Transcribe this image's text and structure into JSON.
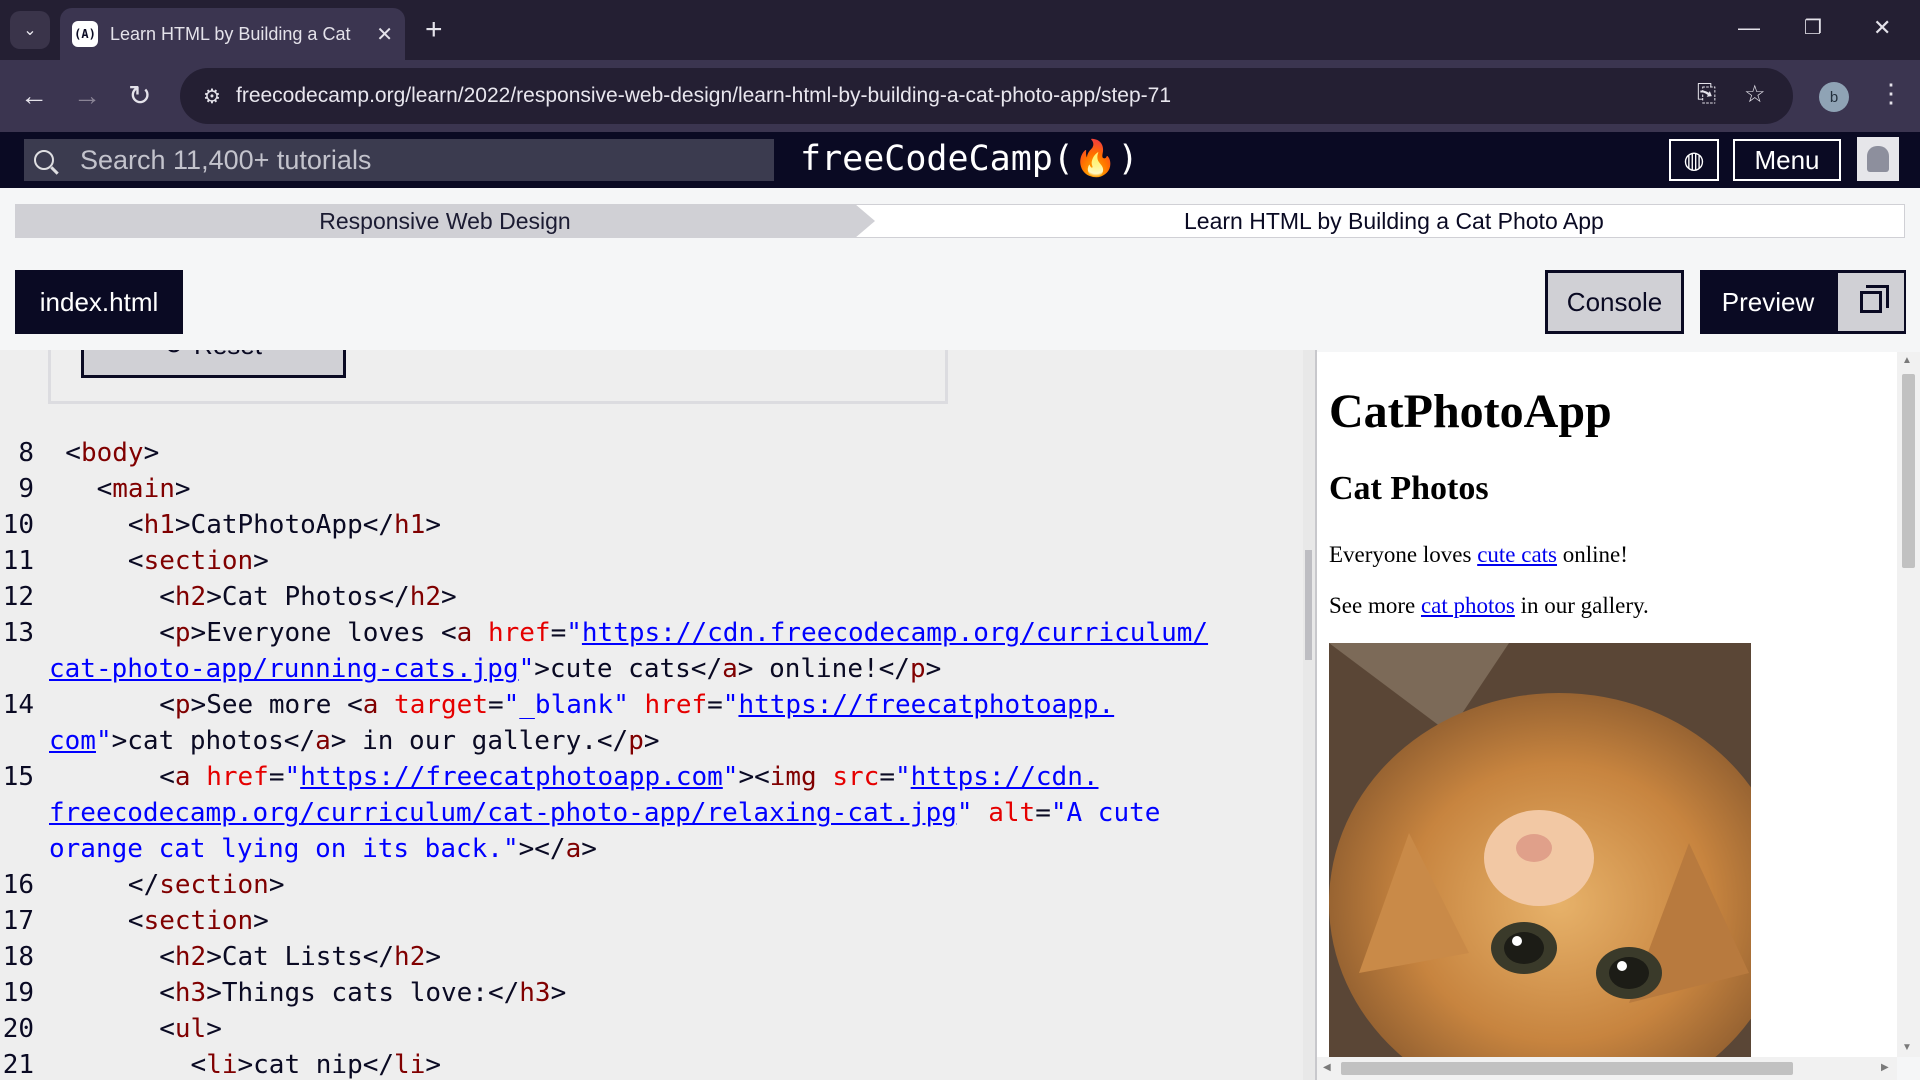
{
  "browser": {
    "tab_title": "Learn HTML by Building a Cat P",
    "favicon_text": "(A)",
    "url": "freecodecamp.org/learn/2022/responsive-web-design/learn-html-by-building-a-cat-photo-app/step-71",
    "profile_initial": "b"
  },
  "fcc_nav": {
    "search_placeholder": "Search 11,400+ tutorials",
    "logo": "freeCodeCamp(🔥)",
    "menu_label": "Menu"
  },
  "breadcrumb": {
    "superblock": "Responsive Web Design",
    "block": "Learn HTML by Building a Cat Photo App"
  },
  "editor_tabs": {
    "file": "index.html",
    "console": "Console",
    "preview": "Preview"
  },
  "action": {
    "reset_label": "⟳ Reset"
  },
  "code_lines": [
    {
      "n": "8",
      "indent": "  ",
      "html": "<body>"
    },
    {
      "n": "9",
      "indent": "    ",
      "html": "<main>"
    },
    {
      "n": "10",
      "indent": "      ",
      "html": "<h1>CatPhotoApp</h1>"
    },
    {
      "n": "11",
      "indent": "      ",
      "html": "<section>"
    },
    {
      "n": "12",
      "indent": "        ",
      "html": "<h2>Cat Photos</h2>"
    },
    {
      "n": "13",
      "indent": "        ",
      "html": "<p>Everyone loves <a href=\"https://cdn.freecodecamp.org/curriculum/"
    },
    {
      "n": "",
      "indent": "",
      "html": "cat-photo-app/running-cats.jpg\">cute cats</a> online!</p>"
    },
    {
      "n": "14",
      "indent": "        ",
      "html": "<p>See more <a target=\"_blank\" href=\"https://freecatphotoapp."
    },
    {
      "n": "",
      "indent": "",
      "html": "com\">cat photos</a> in our gallery.</p>"
    },
    {
      "n": "15",
      "indent": "        ",
      "html": "<a href=\"https://freecatphotoapp.com\"><img src=\"https://cdn."
    },
    {
      "n": "",
      "indent": "",
      "html": "freecodecamp.org/curriculum/cat-photo-app/relaxing-cat.jpg\" alt=\"A cute"
    },
    {
      "n": "",
      "indent": "",
      "html": "orange cat lying on its back.\"></a>"
    },
    {
      "n": "16",
      "indent": "      ",
      "html": "</section>"
    },
    {
      "n": "17",
      "indent": "      ",
      "html": "<section>"
    },
    {
      "n": "18",
      "indent": "        ",
      "html": "<h2>Cat Lists</h2>"
    },
    {
      "n": "19",
      "indent": "        ",
      "html": "<h3>Things cats love:</h3>"
    },
    {
      "n": "20",
      "indent": "        ",
      "html": "<ul>"
    },
    {
      "n": "21",
      "indent": "          ",
      "html": "<li>cat nip</li>"
    }
  ],
  "preview": {
    "h1": "CatPhotoApp",
    "h2": "Cat Photos",
    "p1_before": "Everyone loves ",
    "p1_link": "cute cats",
    "p1_after": " online!",
    "p2_before": "See more ",
    "p2_link": "cat photos",
    "p2_after": " in our gallery.",
    "img_alt": "A cute orange cat lying on its back."
  },
  "colors": {
    "fcc_dark": "#0a0a23",
    "chrome_dark": "#241f33",
    "tag": "#800000",
    "attr": "#e50000",
    "value": "#0000ff"
  }
}
